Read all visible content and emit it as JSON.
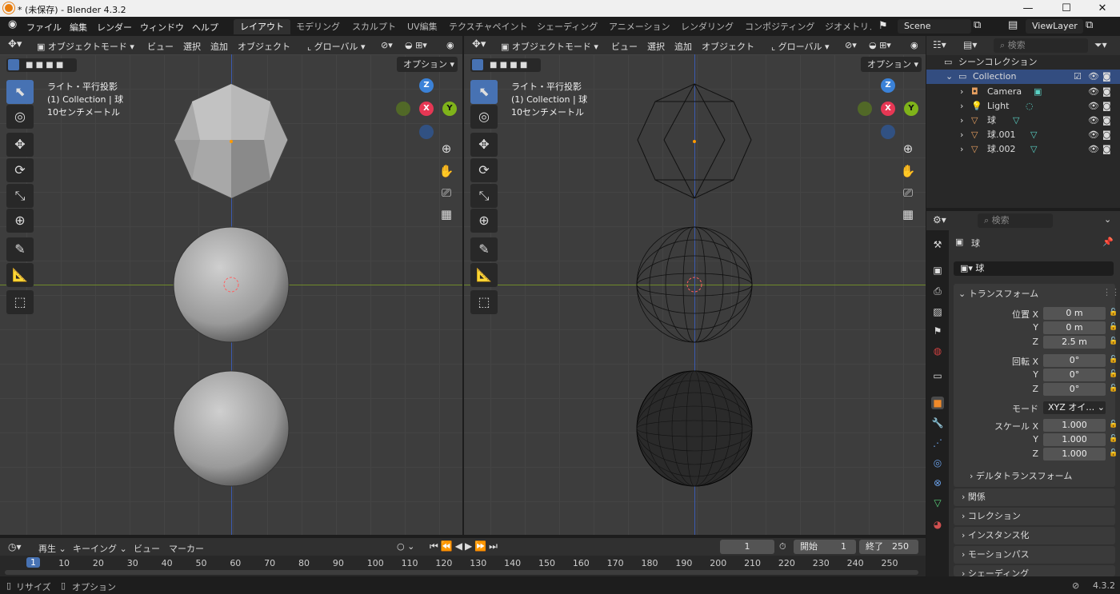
{
  "window": {
    "title": "* (未保存) - Blender 4.3.2",
    "minimize": "—",
    "maximize": "☐",
    "close": "✕"
  },
  "menu": [
    "ファイル",
    "編集",
    "レンダー",
    "ウィンドウ",
    "ヘルプ"
  ],
  "workspaces": [
    "レイアウト",
    "モデリング",
    "スカルプト",
    "UV編集",
    "テクスチャペイント",
    "シェーディング",
    "アニメーション",
    "レンダリング",
    "コンポジティング",
    "ジオメトリノ"
  ],
  "scene": "Scene",
  "view_layer": "ViewLayer",
  "viewport": {
    "mode": "オブジェクトモード",
    "view": "ビュー",
    "select": "選択",
    "add": "追加",
    "object": "オブジェクト",
    "orientation": "グローバル",
    "options": "オプション",
    "info1": "ライト・平行投影",
    "info2": "(1) Collection | 球",
    "info3": "10センチメートル",
    "axis_x": "X",
    "axis_y": "Y",
    "axis_z": "Z"
  },
  "outliner": {
    "search": "検索",
    "root": "シーンコレクション",
    "collection": "Collection",
    "items": [
      "Camera",
      "Light",
      "球",
      "球.001",
      "球.002"
    ]
  },
  "properties": {
    "search": "検索",
    "object_name": "球",
    "data_name": "球",
    "transform": "トランスフォーム",
    "location_label": "位置 X",
    "loc": [
      "0 m",
      "0 m",
      "2.5 m"
    ],
    "rotation_label": "回転 X",
    "rot": [
      "0°",
      "0°",
      "0°"
    ],
    "mode_label": "モード",
    "mode": "XYZ オイ…",
    "scale_label": "スケール X",
    "scale": [
      "1.000",
      "1.000",
      "1.000"
    ],
    "y": "Y",
    "z": "Z",
    "delta": "デルタトランスフォーム",
    "sections": [
      "関係",
      "コレクション",
      "インスタンス化",
      "モーションパス",
      "シェーディング"
    ]
  },
  "timeline": {
    "playback": "再生",
    "keying": "キーイング",
    "view": "ビュー",
    "marker": "マーカー",
    "current": "1",
    "start_label": "開始",
    "start": "1",
    "end_label": "終了",
    "end": "250",
    "ticks": [
      "1",
      "10",
      "20",
      "30",
      "40",
      "50",
      "60",
      "70",
      "80",
      "90",
      "100",
      "110",
      "120",
      "130",
      "140",
      "150",
      "160",
      "170",
      "180",
      "190",
      "200",
      "210",
      "220",
      "230",
      "240",
      "250"
    ]
  },
  "status": {
    "resize": "リサイズ",
    "options": "オプション",
    "version": "4.3.2"
  }
}
